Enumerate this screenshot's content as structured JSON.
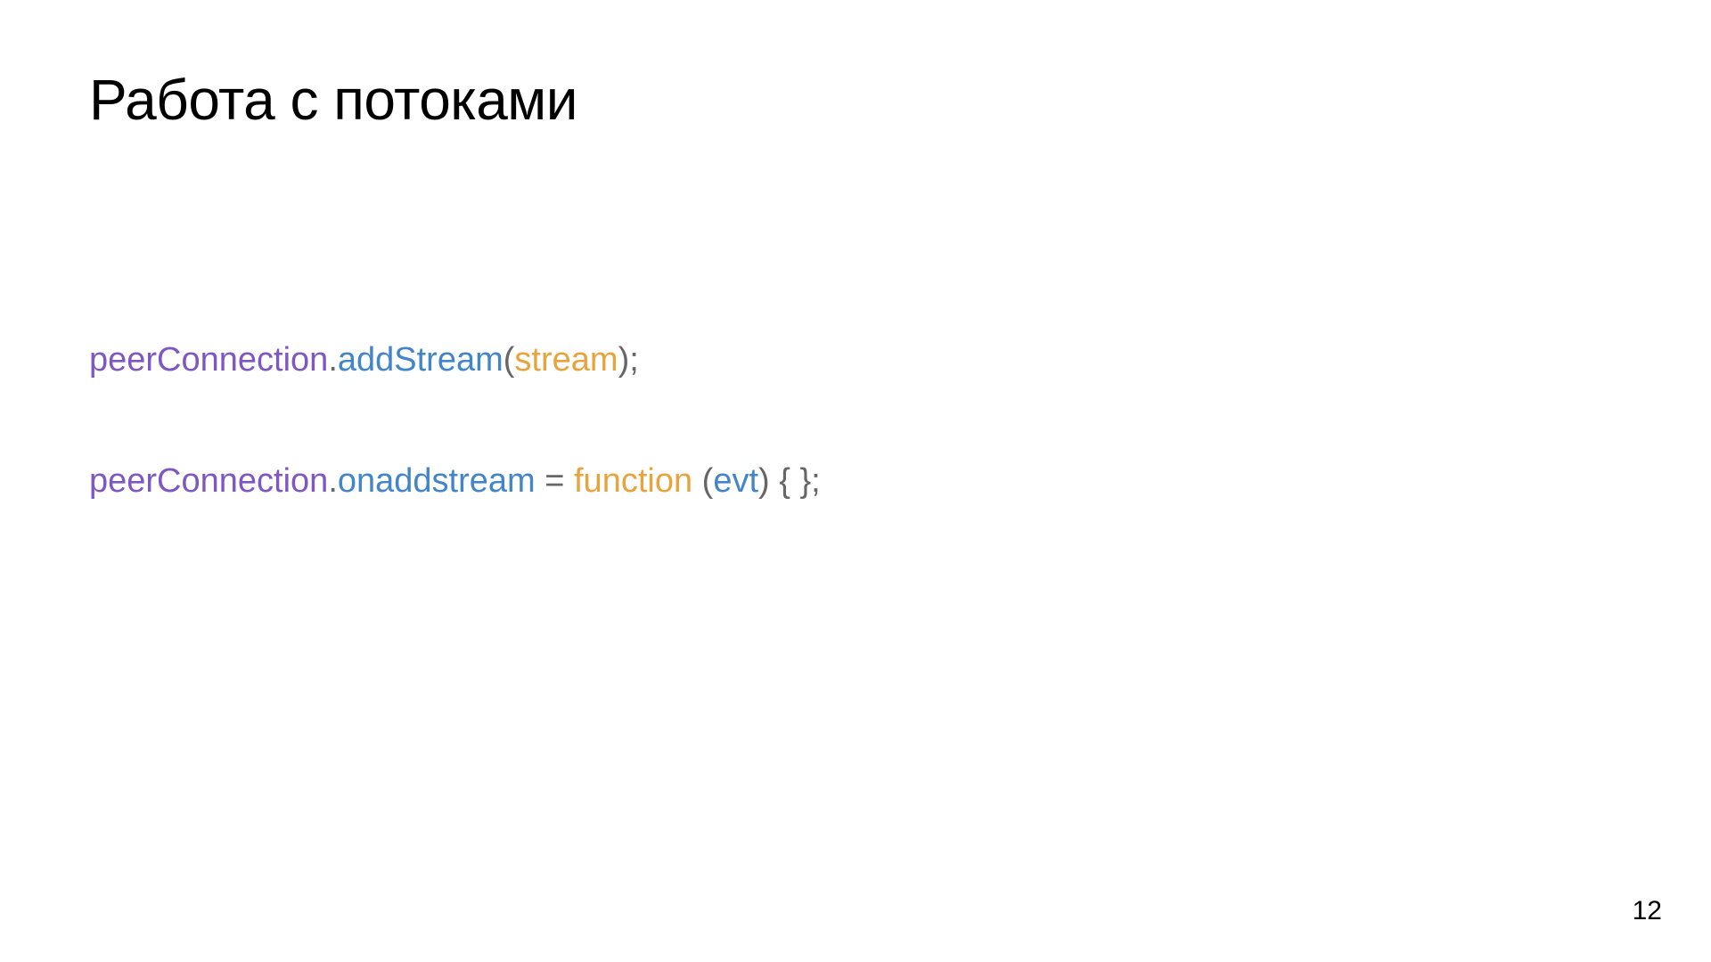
{
  "title": "Работа с потоками",
  "code": {
    "line1": {
      "t1": "peerConnection",
      "t2": ".",
      "t3": "addStream",
      "t4": "(",
      "t5": "stream",
      "t6": ");"
    },
    "line2": {
      "t1": "peerConnection",
      "t2": ".",
      "t3": "onaddstream",
      "t4": " = ",
      "t5": "function",
      "t6": " (",
      "t7": "evt",
      "t8": ") { };"
    }
  },
  "page_number": "12"
}
